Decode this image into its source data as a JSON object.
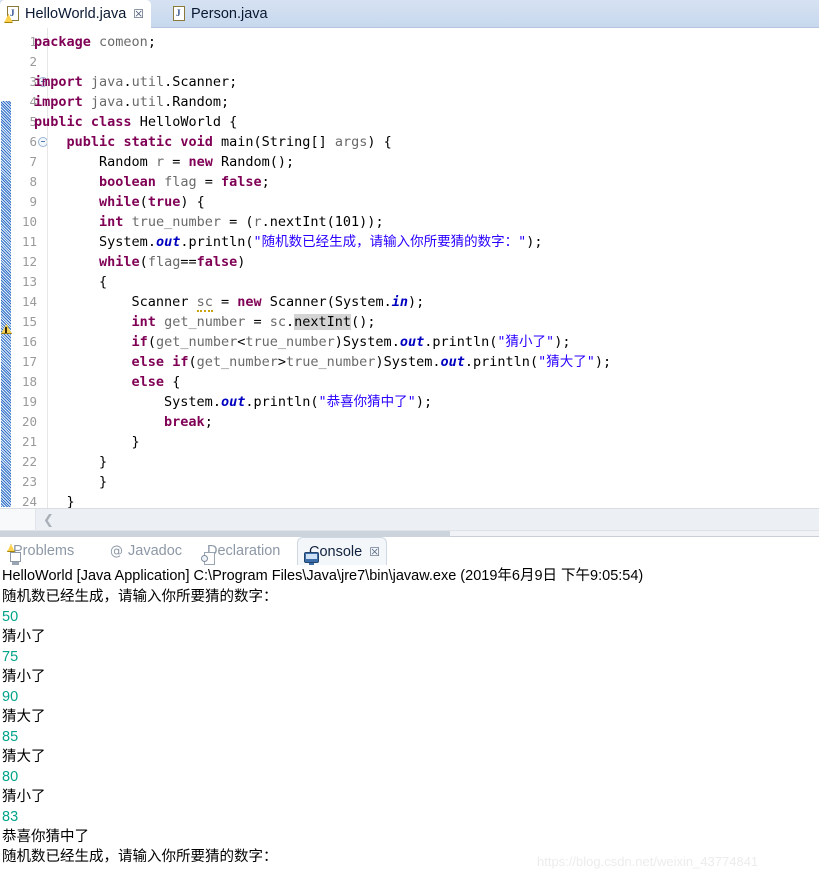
{
  "window": {
    "app": "Eclipse IDE",
    "watermark": "https://blog.csdn.net/weixin_43774841"
  },
  "editor_tabs": [
    {
      "label": "HelloWorld.java",
      "icon": "java-file-warning-icon",
      "close": "☒",
      "active": true
    },
    {
      "label": "Person.java",
      "icon": "java-file-icon",
      "close": "",
      "active": false
    }
  ],
  "editor": {
    "language": "java",
    "selected_text": "nextInt",
    "warning_line": 14,
    "lines": [
      {
        "n": "1",
        "fold": false,
        "text": "package comeon;"
      },
      {
        "n": "2",
        "fold": false,
        "text": ""
      },
      {
        "n": "3",
        "fold": true,
        "text": "import java.util.Scanner;"
      },
      {
        "n": "4",
        "fold": false,
        "text": "import java.util.Random;"
      },
      {
        "n": "5",
        "fold": false,
        "text": "public class HelloWorld {"
      },
      {
        "n": "6",
        "fold": true,
        "text": "    public static void main(String[] args) {"
      },
      {
        "n": "7",
        "fold": false,
        "text": "        Random r = new Random();"
      },
      {
        "n": "8",
        "fold": false,
        "text": "        boolean flag = false;"
      },
      {
        "n": "9",
        "fold": false,
        "text": "        while(true) {"
      },
      {
        "n": "10",
        "fold": false,
        "text": "        int true_number = (r.nextInt(101));"
      },
      {
        "n": "11",
        "fold": false,
        "text": "        System.out.println(\"随机数已经生成，请输入你所要猜的数字：\");"
      },
      {
        "n": "12",
        "fold": false,
        "text": "        while(flag==false)"
      },
      {
        "n": "13",
        "fold": false,
        "text": "        {"
      },
      {
        "n": "14",
        "fold": false,
        "text": "            Scanner sc = new Scanner(System.in);"
      },
      {
        "n": "15",
        "fold": false,
        "text": "            int get_number = sc.nextInt();"
      },
      {
        "n": "16",
        "fold": false,
        "text": "            if(get_number<true_number)System.out.println(\"猜小了\");"
      },
      {
        "n": "17",
        "fold": false,
        "text": "            else if(get_number>true_number)System.out.println(\"猜大了\");"
      },
      {
        "n": "18",
        "fold": false,
        "text": "            else {"
      },
      {
        "n": "19",
        "fold": false,
        "text": "                System.out.println(\"恭喜你猜中了\");"
      },
      {
        "n": "20",
        "fold": false,
        "text": "                break;"
      },
      {
        "n": "21",
        "fold": false,
        "text": "            }"
      },
      {
        "n": "22",
        "fold": false,
        "text": "        }"
      },
      {
        "n": "23",
        "fold": false,
        "text": "        }"
      },
      {
        "n": "24",
        "fold": false,
        "text": "    }"
      }
    ]
  },
  "view_tabs": [
    {
      "label": "Problems",
      "icon": "problems-icon",
      "active": false,
      "close": ""
    },
    {
      "label": "Javadoc",
      "icon": "javadoc-icon",
      "active": false,
      "close": ""
    },
    {
      "label": "Declaration",
      "icon": "declaration-icon",
      "active": false,
      "close": ""
    },
    {
      "label": "Console",
      "icon": "console-icon",
      "active": true,
      "close": "☒"
    }
  ],
  "console": {
    "header": "HelloWorld [Java Application] C:\\Program Files\\Java\\jre7\\bin\\javaw.exe (2019年6月9日 下午9:05:54)",
    "lines": [
      {
        "text": "随机数已经生成，请输入你所要猜的数字：",
        "kind": "out"
      },
      {
        "text": "50",
        "kind": "in"
      },
      {
        "text": "猜小了",
        "kind": "out"
      },
      {
        "text": "75",
        "kind": "in"
      },
      {
        "text": "猜小了",
        "kind": "out"
      },
      {
        "text": "90",
        "kind": "in"
      },
      {
        "text": "猜大了",
        "kind": "out"
      },
      {
        "text": "85",
        "kind": "in"
      },
      {
        "text": "猜大了",
        "kind": "out"
      },
      {
        "text": "80",
        "kind": "in"
      },
      {
        "text": "猜小了",
        "kind": "out"
      },
      {
        "text": "83",
        "kind": "in"
      },
      {
        "text": "恭喜你猜中了",
        "kind": "out"
      },
      {
        "text": "随机数已经生成，请输入你所要猜的数字：",
        "kind": "out"
      }
    ],
    "input_color": "#00a389"
  },
  "scroll": {
    "left_arrow": "❮"
  }
}
